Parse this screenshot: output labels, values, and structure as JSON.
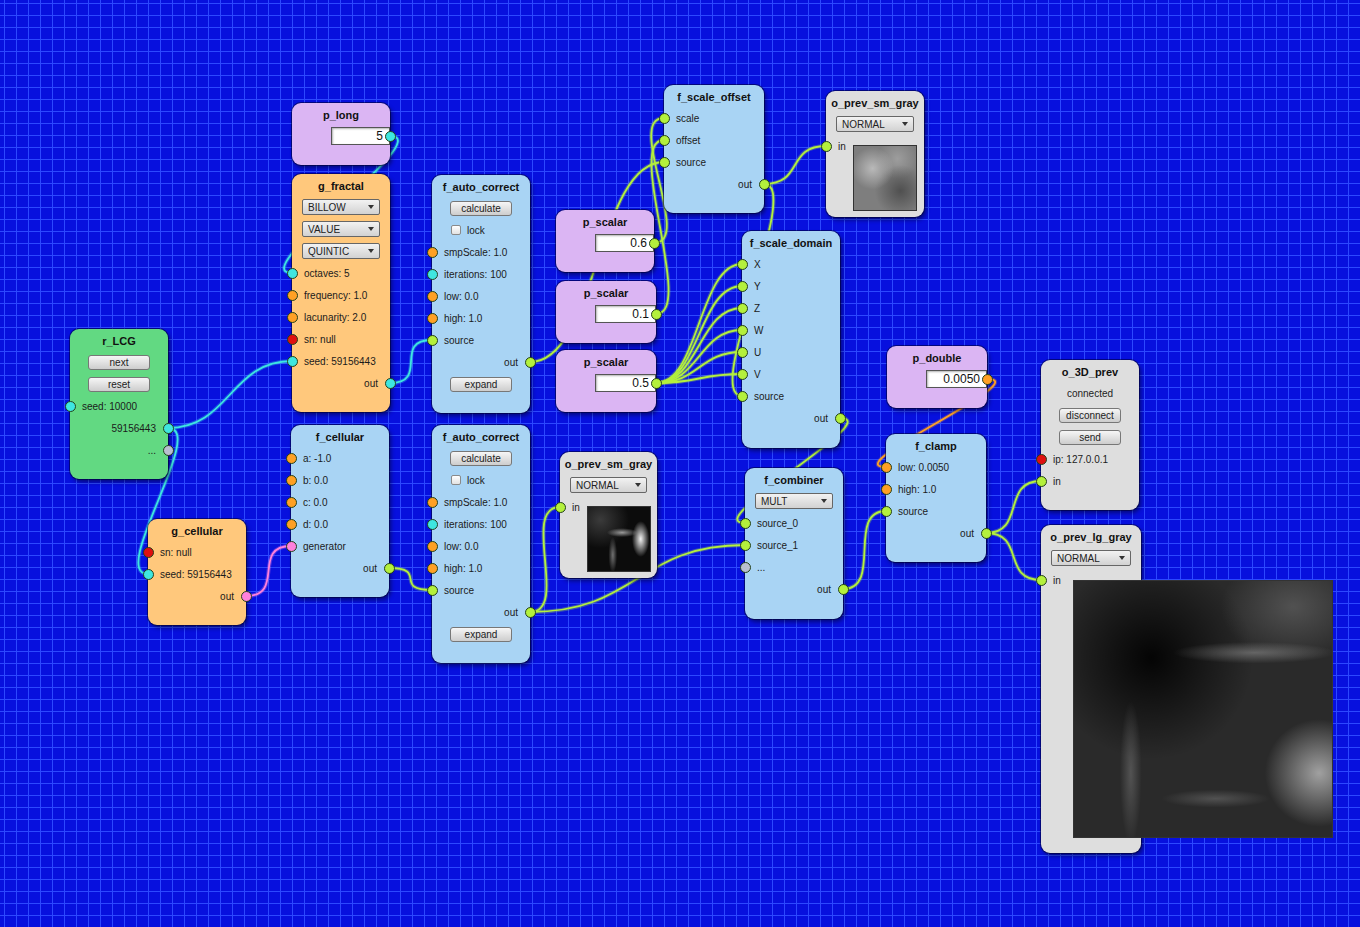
{
  "canvas": {
    "nodes": [
      {
        "title": "p_long",
        "kind": "param",
        "rows": [
          {
            "kind": "input",
            "text": "5",
            "port": {
              "side": "right",
              "color": "#3ee6e0"
            }
          }
        ]
      },
      {
        "title": "g_fractal",
        "kind": "generator",
        "rows": [
          {
            "kind": "dropdown",
            "text": "BILLOW"
          },
          {
            "kind": "dropdown",
            "text": "VALUE"
          },
          {
            "kind": "dropdown",
            "text": "QUINTIC"
          },
          {
            "kind": "port",
            "text": "octaves: 5",
            "port": {
              "side": "left",
              "color": "#3ee6e0"
            }
          },
          {
            "kind": "port",
            "text": "frequency: 1.0",
            "port": {
              "side": "left",
              "color": "#ffa024"
            }
          },
          {
            "kind": "port",
            "text": "lacunarity: 2.0",
            "port": {
              "side": "left",
              "color": "#ffa024"
            }
          },
          {
            "kind": "port",
            "text": "sn: null",
            "port": {
              "side": "left",
              "color": "#e01010"
            }
          },
          {
            "kind": "port",
            "text": "seed: 59156443",
            "port": {
              "side": "left",
              "color": "#3ee6e0"
            }
          },
          {
            "kind": "port",
            "text": "out",
            "port": {
              "side": "right",
              "color": "#3ee6e0"
            }
          }
        ]
      },
      {
        "title": "r_LCG",
        "kind": "random",
        "rows": [
          {
            "kind": "button",
            "text": "next"
          },
          {
            "kind": "button",
            "text": "reset"
          },
          {
            "kind": "port",
            "text": "seed: 10000",
            "port": {
              "side": "left",
              "color": "#3ee6e0"
            }
          },
          {
            "kind": "port",
            "text": "59156443",
            "port": {
              "side": "right",
              "color": "#3ee6e0"
            }
          },
          {
            "kind": "port",
            "text": "...",
            "port": {
              "side": "right",
              "color": "#b8bfd0"
            }
          }
        ]
      },
      {
        "title": "g_cellular",
        "kind": "generator",
        "rows": [
          {
            "kind": "port",
            "text": "sn: null",
            "port": {
              "side": "left",
              "color": "#e01010"
            }
          },
          {
            "kind": "port",
            "text": "seed: 59156443",
            "port": {
              "side": "left",
              "color": "#3ee6e0"
            }
          },
          {
            "kind": "port",
            "text": "out",
            "port": {
              "side": "right",
              "color": "#ff80dc"
            }
          }
        ]
      },
      {
        "title": "f_cellular",
        "kind": "filter",
        "rows": [
          {
            "kind": "port",
            "text": "a: -1.0",
            "port": {
              "side": "left",
              "color": "#ffa024"
            }
          },
          {
            "kind": "port",
            "text": "b: 0.0",
            "port": {
              "side": "left",
              "color": "#ffa024"
            }
          },
          {
            "kind": "port",
            "text": "c: 0.0",
            "port": {
              "side": "left",
              "color": "#ffa024"
            }
          },
          {
            "kind": "port",
            "text": "d: 0.0",
            "port": {
              "side": "left",
              "color": "#ffa024"
            }
          },
          {
            "kind": "port",
            "text": "generator",
            "port": {
              "side": "left",
              "color": "#ff80dc"
            }
          },
          {
            "kind": "port",
            "text": "out",
            "port": {
              "side": "right",
              "color": "#b4f03c"
            }
          }
        ]
      },
      {
        "title": "f_auto_correct",
        "kind": "filter",
        "rows": [
          {
            "kind": "button",
            "text": "calculate"
          },
          {
            "kind": "checkbox",
            "text": "lock",
            "checked": false
          },
          {
            "kind": "port",
            "text": "smpScale: 1.0",
            "port": {
              "side": "left",
              "color": "#ffa024"
            }
          },
          {
            "kind": "port",
            "text": "iterations: 100",
            "port": {
              "side": "left",
              "color": "#3ee6e0"
            }
          },
          {
            "kind": "port",
            "text": "low: 0.0",
            "port": {
              "side": "left",
              "color": "#ffa024"
            }
          },
          {
            "kind": "port",
            "text": "high: 1.0",
            "port": {
              "side": "left",
              "color": "#ffa024"
            }
          },
          {
            "kind": "port",
            "text": "source",
            "port": {
              "side": "left",
              "color": "#b4f03c"
            }
          },
          {
            "kind": "port",
            "text": "out",
            "port": {
              "side": "right",
              "color": "#b4f03c"
            }
          },
          {
            "kind": "button",
            "text": "expand"
          }
        ]
      },
      {
        "title": "f_auto_correct",
        "kind": "filter",
        "rows": [
          {
            "kind": "button",
            "text": "calculate"
          },
          {
            "kind": "checkbox",
            "text": "lock",
            "checked": false
          },
          {
            "kind": "port",
            "text": "smpScale: 1.0",
            "port": {
              "side": "left",
              "color": "#ffa024"
            }
          },
          {
            "kind": "port",
            "text": "iterations: 100",
            "port": {
              "side": "left",
              "color": "#3ee6e0"
            }
          },
          {
            "kind": "port",
            "text": "low: 0.0",
            "port": {
              "side": "left",
              "color": "#ffa024"
            }
          },
          {
            "kind": "port",
            "text": "high: 1.0",
            "port": {
              "side": "left",
              "color": "#ffa024"
            }
          },
          {
            "kind": "port",
            "text": "source",
            "port": {
              "side": "left",
              "color": "#b4f03c"
            }
          },
          {
            "kind": "port",
            "text": "out",
            "port": {
              "side": "right",
              "color": "#b4f03c"
            }
          },
          {
            "kind": "button",
            "text": "expand"
          }
        ]
      },
      {
        "title": "p_scalar",
        "kind": "param",
        "rows": [
          {
            "kind": "input",
            "text": "0.6",
            "port": {
              "side": "right",
              "color": "#b4f03c"
            }
          }
        ]
      },
      {
        "title": "p_scalar",
        "kind": "param",
        "rows": [
          {
            "kind": "input",
            "text": "0.1",
            "port": {
              "side": "right",
              "color": "#b4f03c"
            }
          }
        ]
      },
      {
        "title": "p_scalar",
        "kind": "param",
        "rows": [
          {
            "kind": "input",
            "text": "0.5",
            "port": {
              "side": "right",
              "color": "#b4f03c"
            }
          }
        ]
      },
      {
        "title": "f_scale_offset",
        "kind": "filter",
        "rows": [
          {
            "kind": "port",
            "text": "scale",
            "port": {
              "side": "left",
              "color": "#b4f03c"
            }
          },
          {
            "kind": "port",
            "text": "offset",
            "port": {
              "side": "left",
              "color": "#b4f03c"
            }
          },
          {
            "kind": "port",
            "text": "source",
            "port": {
              "side": "left",
              "color": "#b4f03c"
            }
          },
          {
            "kind": "port",
            "text": "out",
            "port": {
              "side": "right",
              "color": "#b4f03c"
            }
          }
        ]
      },
      {
        "title": "o_prev_sm_gray",
        "kind": "output",
        "preview": {
          "size": "small",
          "tone": "light"
        },
        "rows": [
          {
            "kind": "dropdown",
            "text": "NORMAL"
          },
          {
            "kind": "port",
            "text": "in",
            "port": {
              "side": "left",
              "color": "#b4f03c"
            }
          }
        ]
      },
      {
        "title": "o_prev_sm_gray",
        "kind": "output",
        "preview": {
          "size": "small",
          "tone": "dark"
        },
        "rows": [
          {
            "kind": "dropdown",
            "text": "NORMAL"
          },
          {
            "kind": "port",
            "text": "in",
            "port": {
              "side": "left",
              "color": "#b4f03c"
            }
          }
        ]
      },
      {
        "title": "f_scale_domain",
        "kind": "filter",
        "rows": [
          {
            "kind": "port",
            "text": "X",
            "port": {
              "side": "left",
              "color": "#b4f03c"
            }
          },
          {
            "kind": "port",
            "text": "Y",
            "port": {
              "side": "left",
              "color": "#b4f03c"
            }
          },
          {
            "kind": "port",
            "text": "Z",
            "port": {
              "side": "left",
              "color": "#b4f03c"
            }
          },
          {
            "kind": "port",
            "text": "W",
            "port": {
              "side": "left",
              "color": "#b4f03c"
            }
          },
          {
            "kind": "port",
            "text": "U",
            "port": {
              "side": "left",
              "color": "#b4f03c"
            }
          },
          {
            "kind": "port",
            "text": "V",
            "port": {
              "side": "left",
              "color": "#b4f03c"
            }
          },
          {
            "kind": "port",
            "text": "source",
            "port": {
              "side": "left",
              "color": "#b4f03c"
            }
          },
          {
            "kind": "port",
            "text": "out",
            "port": {
              "side": "right",
              "color": "#b4f03c"
            }
          }
        ]
      },
      {
        "title": "p_double",
        "kind": "param",
        "rows": [
          {
            "kind": "input",
            "text": "0.0050",
            "port": {
              "side": "right",
              "color": "#ffa024"
            }
          }
        ]
      },
      {
        "title": "f_combiner",
        "kind": "filter",
        "rows": [
          {
            "kind": "dropdown",
            "text": "MULT"
          },
          {
            "kind": "port",
            "text": "source_0",
            "port": {
              "side": "left",
              "color": "#b4f03c"
            }
          },
          {
            "kind": "port",
            "text": "source_1",
            "port": {
              "side": "left",
              "color": "#b4f03c"
            }
          },
          {
            "kind": "port",
            "text": "...",
            "port": {
              "side": "left",
              "color": "#b8bfd0"
            }
          },
          {
            "kind": "port",
            "text": "out",
            "port": {
              "side": "right",
              "color": "#b4f03c"
            }
          }
        ]
      },
      {
        "title": "f_clamp",
        "kind": "filter",
        "rows": [
          {
            "kind": "port",
            "text": "low: 0.0050",
            "port": {
              "side": "left",
              "color": "#ffa024"
            }
          },
          {
            "kind": "port",
            "text": "high: 1.0",
            "port": {
              "side": "left",
              "color": "#ffa024"
            }
          },
          {
            "kind": "port",
            "text": "source",
            "port": {
              "side": "left",
              "color": "#b4f03c"
            }
          },
          {
            "kind": "port",
            "text": "out",
            "port": {
              "side": "right",
              "color": "#b4f03c"
            }
          }
        ]
      },
      {
        "title": "o_3D_prev",
        "kind": "output",
        "rows": [
          {
            "kind": "text",
            "text": "connected"
          },
          {
            "kind": "button",
            "text": "disconnect"
          },
          {
            "kind": "button",
            "text": "send"
          },
          {
            "kind": "port",
            "text": "ip: 127.0.0.1",
            "port": {
              "side": "left",
              "color": "#e01010"
            }
          },
          {
            "kind": "port",
            "text": "in",
            "port": {
              "side": "left",
              "color": "#b4f03c"
            }
          }
        ]
      },
      {
        "title": "o_prev_lg_gray",
        "kind": "output",
        "preview": {
          "size": "large",
          "tone": "dark"
        },
        "rows": [
          {
            "kind": "dropdown",
            "text": "NORMAL"
          },
          {
            "kind": "port",
            "text": "in",
            "port": {
              "side": "left",
              "color": "#b4f03c"
            }
          }
        ]
      }
    ],
    "wires": [
      {
        "from": [
          0,
          0
        ],
        "to": [
          1,
          3
        ]
      },
      {
        "from": [
          2,
          3
        ],
        "to": [
          1,
          7
        ]
      },
      {
        "from": [
          2,
          3
        ],
        "to": [
          3,
          1
        ]
      },
      {
        "from": [
          3,
          2
        ],
        "to": [
          4,
          4
        ]
      },
      {
        "from": [
          1,
          8
        ],
        "to": [
          5,
          6
        ]
      },
      {
        "from": [
          4,
          5
        ],
        "to": [
          6,
          6
        ]
      },
      {
        "from": [
          6,
          7
        ],
        "to": [
          12,
          1
        ]
      },
      {
        "from": [
          6,
          7
        ],
        "to": [
          15,
          2
        ]
      },
      {
        "from": [
          5,
          7
        ],
        "to": [
          10,
          2
        ]
      },
      {
        "from": [
          7,
          0
        ],
        "to": [
          10,
          0
        ]
      },
      {
        "from": [
          8,
          0
        ],
        "to": [
          10,
          1
        ]
      },
      {
        "from": [
          9,
          0
        ],
        "to": [
          13,
          0
        ]
      },
      {
        "from": [
          9,
          0
        ],
        "to": [
          13,
          1
        ]
      },
      {
        "from": [
          9,
          0
        ],
        "to": [
          13,
          2
        ]
      },
      {
        "from": [
          9,
          0
        ],
        "to": [
          13,
          3
        ]
      },
      {
        "from": [
          9,
          0
        ],
        "to": [
          13,
          4
        ]
      },
      {
        "from": [
          9,
          0
        ],
        "to": [
          13,
          5
        ]
      },
      {
        "from": [
          10,
          3
        ],
        "to": [
          11,
          1
        ]
      },
      {
        "from": [
          10,
          3
        ],
        "to": [
          13,
          6
        ]
      },
      {
        "from": [
          13,
          7
        ],
        "to": [
          15,
          1
        ]
      },
      {
        "from": [
          15,
          4
        ],
        "to": [
          16,
          2
        ]
      },
      {
        "from": [
          14,
          0
        ],
        "to": [
          16,
          0
        ]
      },
      {
        "from": [
          16,
          3
        ],
        "to": [
          17,
          4
        ]
      },
      {
        "from": [
          16,
          3
        ],
        "to": [
          18,
          1
        ]
      }
    ]
  }
}
